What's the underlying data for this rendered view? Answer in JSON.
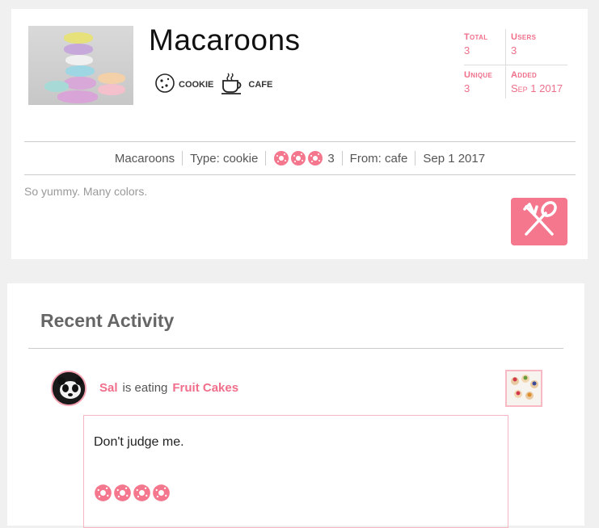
{
  "item": {
    "title": "Macaroons",
    "tags": [
      {
        "icon": "cookie-icon",
        "label": "COOKIE"
      },
      {
        "icon": "cup-icon",
        "label": "CAFE"
      }
    ]
  },
  "stats": {
    "total_label": "Total",
    "total_value": "3",
    "users_label": "Users",
    "users_value": "3",
    "unique_label": "Unique",
    "unique_value": "3",
    "added_label": "Added",
    "added_value": "Sep 1 2017"
  },
  "infobar": {
    "name": "Macaroons",
    "type": "Type: cookie",
    "rating_value": "3",
    "rating_icons": 3,
    "from": "From: cafe",
    "date": "Sep 1 2017"
  },
  "description": "So yummy. Many colors.",
  "activity": {
    "title": "Recent Activity",
    "user": "Sal",
    "verb": "is eating",
    "food": "Fruit Cakes",
    "comment": "Don't judge me.",
    "rating_icons": 4
  },
  "colors": {
    "accent": "#f4778e",
    "text_pink": "#ef6f8a"
  }
}
